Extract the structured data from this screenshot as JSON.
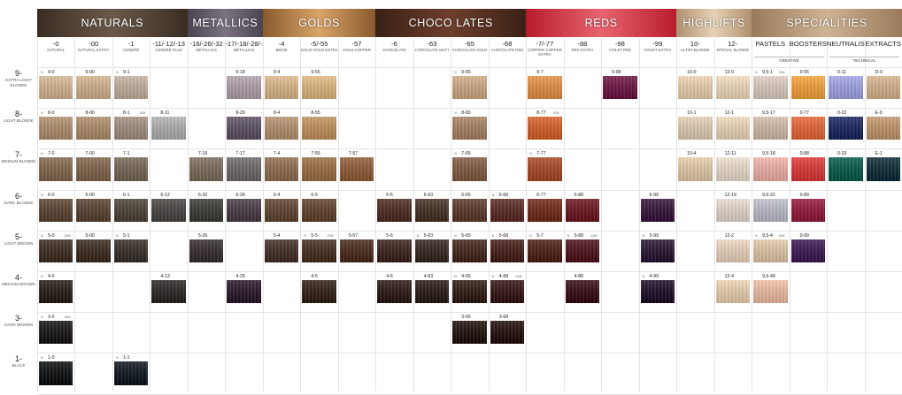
{
  "categories": [
    {
      "label": "NATURALS",
      "c1": "#3a2c22",
      "c2": "#6b5a4a",
      "start": 0,
      "span": 4
    },
    {
      "label": "METALLICS",
      "c1": "#4a4452",
      "c2": "#7a7280",
      "start": 4,
      "span": 2
    },
    {
      "label": "GOLDS",
      "c1": "#8a5a2e",
      "c2": "#d8a468",
      "start": 6,
      "span": 3
    },
    {
      "label": "CHOCO LATES",
      "c1": "#3a2016",
      "c2": "#6e3e2c",
      "start": 9,
      "span": 4
    },
    {
      "label": "REDS",
      "c1": "#b81c2c",
      "c2": "#e86470",
      "start": 13,
      "span": 4
    },
    {
      "label": "HIGHLIFTS",
      "c1": "#b09070",
      "c2": "#e6d2b4",
      "start": 17,
      "span": 2
    },
    {
      "label": "SPECIALITIES",
      "c1": "#9a7a5a",
      "c2": "#cfb394",
      "start": 19,
      "span": 4
    }
  ],
  "columns": [
    {
      "code": "-0",
      "name": "NATURAL"
    },
    {
      "code": "-00",
      "name": "NATURAL EXTRA"
    },
    {
      "code": "-1",
      "name": "CENDRÉ"
    },
    {
      "code": "-11/-12/-13",
      "name": "CENDRÉ PLUS"
    },
    {
      "code": "-16/-26/-32",
      "name": "METALLICS"
    },
    {
      "code": "-17/-18/-28/-29",
      "name": "METALLICS"
    },
    {
      "code": "-4",
      "name": "BEIGE"
    },
    {
      "code": "-5/-55",
      "name": "GOLD/ GOLD EXTRA"
    },
    {
      "code": "-57",
      "name": "GOLD COPPER"
    },
    {
      "code": "-6",
      "name": "CHOCOLATE"
    },
    {
      "code": "-63",
      "name": "CHOCOLATE MATT"
    },
    {
      "code": "-65",
      "name": "CHOCOLATE GOLD"
    },
    {
      "code": "-68",
      "name": "CHOCOLATE RED"
    },
    {
      "code": "-7/-77",
      "name": "COPPER/ COPPER EXTRA"
    },
    {
      "code": "-88",
      "name": "RED EXTRA"
    },
    {
      "code": "-98",
      "name": "VIOLET RED"
    },
    {
      "code": "-99",
      "name": "VIOLET EXTRA"
    },
    {
      "code": "10-",
      "name": "ULTRA BLONDE"
    },
    {
      "code": "12-",
      "name": "SPECIAL BLONDE"
    },
    {
      "code": "PASTELS",
      "name": ""
    },
    {
      "code": "BOOSTERS",
      "name": ""
    },
    {
      "code": "NEUTRALISERS",
      "name": ""
    },
    {
      "code": "EXTRACTS",
      "name": ""
    }
  ],
  "subheads": [
    {
      "label": "CREATIVE",
      "start": 19,
      "span": 2
    },
    {
      "label": "TECHNICAL",
      "start": 21,
      "span": 2
    }
  ],
  "rows": [
    {
      "level": "9-",
      "name": "EXTRA LIGHT BLONDE"
    },
    {
      "level": "8-",
      "name": "LIGHT BLONDE"
    },
    {
      "level": "7-",
      "name": "MEDIUM BLONDE"
    },
    {
      "level": "6-",
      "name": "DARK BLONDE"
    },
    {
      "level": "5-",
      "name": "LIGHT BROWN"
    },
    {
      "level": "4-",
      "name": "MEDIUM BROWN"
    },
    {
      "level": "3-",
      "name": "DARK BROWN"
    },
    {
      "level": "1-",
      "name": "BLACK"
    }
  ],
  "swatches": [
    {
      "row": 0,
      "col": 0,
      "label": "9-0",
      "n": "N",
      "color": "#c9ad8c"
    },
    {
      "row": 0,
      "col": 1,
      "label": "9-00",
      "color": "#c6aa88"
    },
    {
      "row": 0,
      "col": 2,
      "label": "9-1",
      "n": "N",
      "color": "#b9a898"
    },
    {
      "row": 0,
      "col": 5,
      "label": "9-18",
      "color": "#a89aa4"
    },
    {
      "row": 0,
      "col": 6,
      "label": "9-4",
      "color": "#cfae86"
    },
    {
      "row": 0,
      "col": 7,
      "label": "9-55",
      "color": "#d3ae7c"
    },
    {
      "row": 0,
      "col": 11,
      "label": "9-65",
      "n": "N",
      "color": "#c4a280"
    },
    {
      "row": 0,
      "col": 13,
      "label": "9-7",
      "color": "#d78a48"
    },
    {
      "row": 0,
      "col": 15,
      "label": "9-98",
      "color": "#6a1a44"
    },
    {
      "row": 0,
      "col": 17,
      "label": "10-0",
      "color": "#dcc6a8"
    },
    {
      "row": 0,
      "col": 18,
      "label": "12-0",
      "color": "#e2ceb2"
    },
    {
      "row": 0,
      "col": 19,
      "label": "9,5-1",
      "n": "N",
      "ig": "IGM",
      "color": "#cfc1b6"
    },
    {
      "row": 0,
      "col": 20,
      "label": "0-55",
      "color": "#e49a3c"
    },
    {
      "row": 0,
      "col": 21,
      "label": "0-11",
      "color": "#9a9cd8"
    },
    {
      "row": 0,
      "col": 22,
      "label": "D-0",
      "color": "#cbaa88"
    },
    {
      "row": 1,
      "col": 0,
      "label": "8-0",
      "n": "N",
      "color": "#a88a6c"
    },
    {
      "row": 1,
      "col": 1,
      "label": "8-00",
      "color": "#a68868"
    },
    {
      "row": 1,
      "col": 2,
      "label": "8-1",
      "ig": "IGM",
      "color": "#9a8a7e"
    },
    {
      "row": 1,
      "col": 3,
      "label": "8-11",
      "color": "#a8a8a8"
    },
    {
      "row": 1,
      "col": 5,
      "label": "8-29",
      "color": "#5c5264"
    },
    {
      "row": 1,
      "col": 6,
      "label": "8-4",
      "color": "#ab8c6c"
    },
    {
      "row": 1,
      "col": 7,
      "label": "8-55",
      "color": "#b88c5c"
    },
    {
      "row": 1,
      "col": 11,
      "label": "8-65",
      "n": "N",
      "color": "#a07e62"
    },
    {
      "row": 1,
      "col": 13,
      "label": "8-77",
      "ig": "IGM",
      "color": "#c8602c"
    },
    {
      "row": 1,
      "col": 17,
      "label": "10-1",
      "color": "#d4c2aa"
    },
    {
      "row": 1,
      "col": 18,
      "label": "12-1",
      "color": "#dfcbb2"
    },
    {
      "row": 1,
      "col": 19,
      "label": "9,5-17",
      "color": "#c8b2a0"
    },
    {
      "row": 1,
      "col": 20,
      "label": "0-77",
      "color": "#d8643a"
    },
    {
      "row": 1,
      "col": 21,
      "label": "0-22",
      "color": "#1e2a5c"
    },
    {
      "row": 1,
      "col": 22,
      "label": "E-0",
      "color": "#b8906a"
    },
    {
      "row": 2,
      "col": 0,
      "label": "7-0",
      "n": "N",
      "color": "#7e664e"
    },
    {
      "row": 2,
      "col": 1,
      "label": "7-00",
      "color": "#7c644c"
    },
    {
      "row": 2,
      "col": 2,
      "label": "7-1",
      "color": "#746656"
    },
    {
      "row": 2,
      "col": 4,
      "label": "7-16",
      "color": "#786a5c"
    },
    {
      "row": 2,
      "col": 5,
      "label": "7-17",
      "color": "#6c6668"
    },
    {
      "row": 2,
      "col": 6,
      "label": "7-4",
      "color": "#8a6c50"
    },
    {
      "row": 2,
      "col": 7,
      "label": "7-55",
      "color": "#946c44"
    },
    {
      "row": 2,
      "col": 8,
      "label": "7-57",
      "color": "#8a5c3a"
    },
    {
      "row": 2,
      "col": 11,
      "label": "7-65",
      "n": "N",
      "color": "#7e5a44"
    },
    {
      "row": 2,
      "col": 13,
      "label": "7-77",
      "n": "N",
      "color": "#a04a2a"
    },
    {
      "row": 2,
      "col": 17,
      "label": "10-4",
      "color": "#d6c0a2"
    },
    {
      "row": 2,
      "col": 18,
      "label": "12-11",
      "color": "#ddd0c2"
    },
    {
      "row": 2,
      "col": 19,
      "label": "9,5-18",
      "color": "#e0a8a0"
    },
    {
      "row": 2,
      "col": 20,
      "label": "0-88",
      "color": "#d03a3a"
    },
    {
      "row": 2,
      "col": 21,
      "label": "0-33",
      "color": "#0e5a4a"
    },
    {
      "row": 2,
      "col": 22,
      "label": "E-1",
      "color": "#14303a"
    },
    {
      "row": 3,
      "col": 0,
      "label": "6-0",
      "n": "N",
      "color": "#5a4636"
    },
    {
      "row": 3,
      "col": 1,
      "label": "6-00",
      "color": "#584434"
    },
    {
      "row": 3,
      "col": 2,
      "label": "6-1",
      "color": "#4e443a"
    },
    {
      "row": 3,
      "col": 3,
      "label": "6-12",
      "color": "#4a4644"
    },
    {
      "row": 3,
      "col": 4,
      "label": "6-32",
      "color": "#3e3e38"
    },
    {
      "row": 3,
      "col": 5,
      "label": "6-28",
      "color": "#4a3e48"
    },
    {
      "row": 3,
      "col": 6,
      "label": "6-4",
      "color": "#5e4634"
    },
    {
      "row": 3,
      "col": 7,
      "label": "6-5",
      "color": "#604430"
    },
    {
      "row": 3,
      "col": 9,
      "label": "6-6",
      "color": "#4e3026"
    },
    {
      "row": 3,
      "col": 10,
      "label": "6-63",
      "color": "#463428"
    },
    {
      "row": 3,
      "col": 11,
      "label": "6-65",
      "color": "#5a3c2c"
    },
    {
      "row": 3,
      "col": 12,
      "label": "6-68",
      "n": "N",
      "color": "#5a2e28"
    },
    {
      "row": 3,
      "col": 13,
      "label": "6-77",
      "color": "#6e2e1e"
    },
    {
      "row": 3,
      "col": 14,
      "label": "6-88",
      "color": "#6a1c24"
    },
    {
      "row": 3,
      "col": 16,
      "label": "6-99",
      "color": "#3a1a3c"
    },
    {
      "row": 3,
      "col": 18,
      "label": "12-19",
      "color": "#d8ccc4"
    },
    {
      "row": 3,
      "col": 19,
      "label": "9,5-22",
      "color": "#b4b4c0"
    },
    {
      "row": 3,
      "col": 20,
      "label": "0-89",
      "color": "#8e1e3e"
    },
    {
      "row": 4,
      "col": 0,
      "label": "5-0",
      "n": "N",
      "ig": "IGM",
      "color": "#3e3026"
    },
    {
      "row": 4,
      "col": 1,
      "label": "5-00",
      "color": "#3c2e24"
    },
    {
      "row": 4,
      "col": 2,
      "label": "5-1",
      "n": "N",
      "color": "#3a322c"
    },
    {
      "row": 4,
      "col": 4,
      "label": "5-26",
      "color": "#383034"
    },
    {
      "row": 4,
      "col": 6,
      "label": "5-4",
      "color": "#44322a"
    },
    {
      "row": 4,
      "col": 7,
      "label": "5-5",
      "n": "N",
      "ig": "IGM",
      "color": "#463224"
    },
    {
      "row": 4,
      "col": 8,
      "label": "5-57",
      "color": "#4a2e20"
    },
    {
      "row": 4,
      "col": 9,
      "label": "5-6",
      "color": "#3e2620"
    },
    {
      "row": 4,
      "col": 10,
      "label": "5-63",
      "n": "N",
      "color": "#382a24"
    },
    {
      "row": 4,
      "col": 11,
      "label": "5-65",
      "n": "N",
      "color": "#442a20"
    },
    {
      "row": 4,
      "col": 12,
      "label": "5-68",
      "n": "N",
      "color": "#46221e"
    },
    {
      "row": 4,
      "col": 13,
      "label": "5-7",
      "n": "N",
      "color": "#4c2418"
    },
    {
      "row": 4,
      "col": 14,
      "label": "5-88",
      "n": "N",
      "ig": "IGM",
      "color": "#4e1820"
    },
    {
      "row": 4,
      "col": 16,
      "label": "5-99",
      "n": "N",
      "color": "#2c1a34"
    },
    {
      "row": 4,
      "col": 18,
      "label": "12-2",
      "color": "#dcc8b4"
    },
    {
      "row": 4,
      "col": 19,
      "label": "9,5-4",
      "n": "N",
      "ig": "IGM",
      "color": "#d4bca0"
    },
    {
      "row": 4,
      "col": 20,
      "label": "0-99",
      "color": "#3e1e54"
    },
    {
      "row": 5,
      "col": 0,
      "label": "4-0",
      "n": "N",
      "color": "#2c221c"
    },
    {
      "row": 5,
      "col": 3,
      "label": "4-13",
      "color": "#2e2a28"
    },
    {
      "row": 5,
      "col": 5,
      "label": "4-29",
      "color": "#2e1e2e"
    },
    {
      "row": 5,
      "col": 7,
      "label": "4-5",
      "color": "#34241c"
    },
    {
      "row": 5,
      "col": 9,
      "label": "4-6",
      "color": "#2e1e1a"
    },
    {
      "row": 5,
      "col": 10,
      "label": "4-63",
      "color": "#2c201c"
    },
    {
      "row": 5,
      "col": 11,
      "label": "4-65",
      "n": "N",
      "color": "#32201a"
    },
    {
      "row": 5,
      "col": 12,
      "label": "4-68",
      "n": "N",
      "ig": "IGM",
      "color": "#361a18"
    },
    {
      "row": 5,
      "col": 14,
      "label": "4-88",
      "color": "#3a121a"
    },
    {
      "row": 5,
      "col": 16,
      "label": "4-99",
      "n": "N",
      "color": "#22142a"
    },
    {
      "row": 5,
      "col": 18,
      "label": "12-4",
      "color": "#dcc6a8"
    },
    {
      "row": 5,
      "col": 19,
      "label": "9,5-49",
      "color": "#e0b49c"
    },
    {
      "row": 6,
      "col": 0,
      "label": "3-0",
      "n": "N",
      "ig": "IGM",
      "color": "#1c1a1a"
    },
    {
      "row": 6,
      "col": 11,
      "label": "3-65",
      "color": "#24160f"
    },
    {
      "row": 6,
      "col": 12,
      "label": "3-68",
      "color": "#261412"
    },
    {
      "row": 7,
      "col": 0,
      "label": "1-0",
      "n": "N",
      "color": "#121416"
    },
    {
      "row": 7,
      "col": 2,
      "label": "1-1",
      "n": "N",
      "color": "#161c24"
    }
  ]
}
